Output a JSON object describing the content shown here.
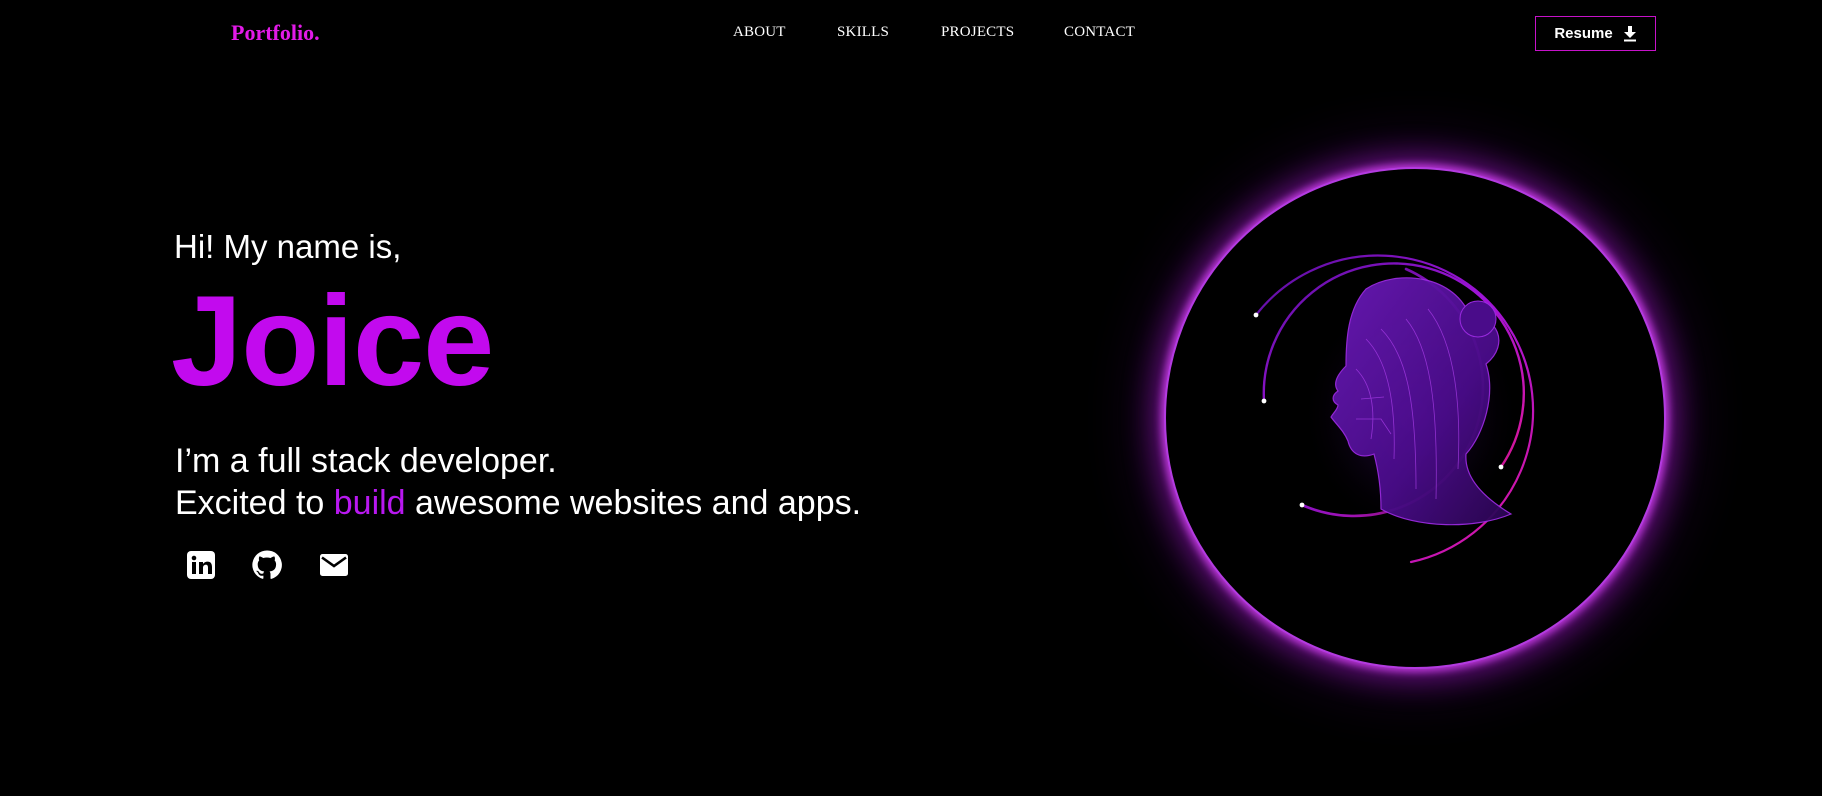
{
  "nav": {
    "logo": "Portfolio.",
    "links": [
      "ABOUT",
      "SKILLS",
      "PROJECTS",
      "CONTACT"
    ],
    "resume_label": "Resume"
  },
  "hero": {
    "greeting": "Hi! My name is,",
    "name": "Joice",
    "line1": "I’m a full stack developer.",
    "line2_pre": "Excited to ",
    "line2_accent": "build",
    "line2_post": " awesome websites and apps."
  },
  "social": {
    "icons": [
      "linkedin-icon",
      "github-icon",
      "mail-icon"
    ]
  },
  "colors": {
    "background": "#000000",
    "accent": "#c20aee",
    "logo": "#e21ae8",
    "button_border": "#c612c9"
  }
}
